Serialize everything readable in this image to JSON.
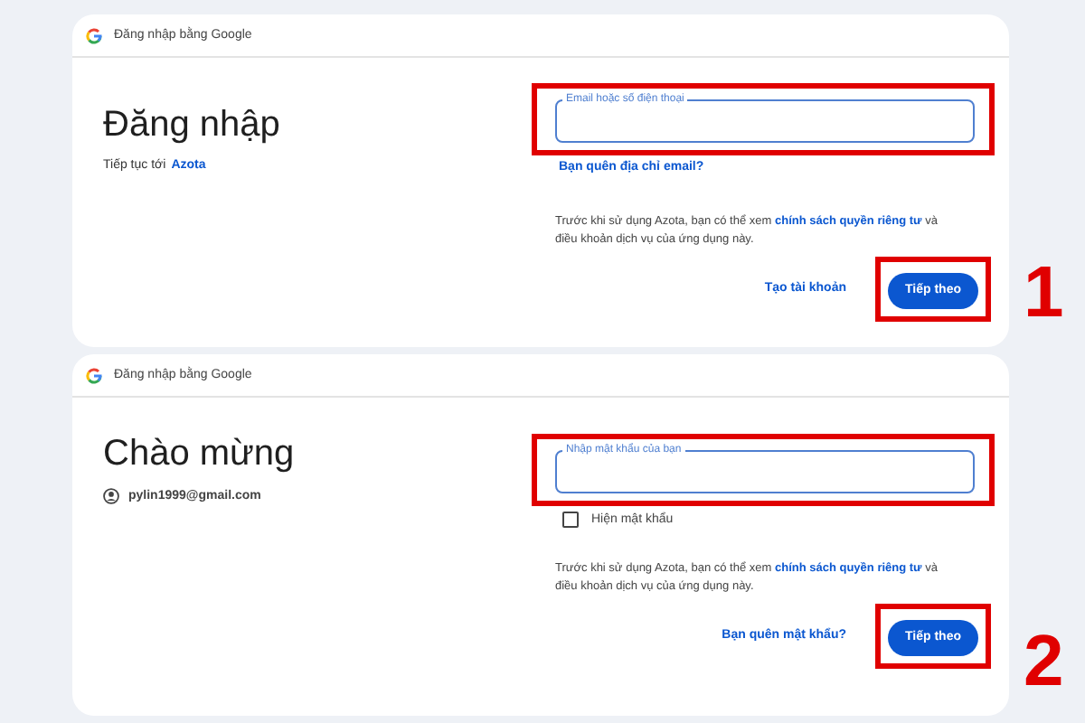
{
  "steps": [
    {
      "kind": "email",
      "header": "Đăng nhập bằng Google",
      "title": "Đăng nhập",
      "subtitle_prefix": "Tiếp tục tới",
      "subtitle_link": "Azota",
      "field_label": "Email hoặc số điện thoại",
      "helper_link": "Bạn quên địa chỉ email?",
      "privacy_before": "Trước khi sử dụng Azota, bạn có thể xem",
      "privacy_link": "chính sách quyền riêng tư",
      "privacy_after": "và điều khoản dịch vụ của ứng dụng này.",
      "secondary_action": "Tạo tài khoản",
      "primary_action": "Tiếp theo",
      "step_number": "1"
    },
    {
      "kind": "password",
      "header": "Đăng nhập bằng Google",
      "title": "Chào mừng",
      "account": "pylin1999@gmail.com",
      "field_label": "Nhập mật khẩu của bạn",
      "show_password": {
        "label": "Hiện mật khẩu",
        "checked": false
      },
      "privacy_before": "Trước khi sử dụng Azota, bạn có thể xem",
      "privacy_link": "chính sách quyền riêng tư",
      "privacy_after": "và điều khoản dịch vụ của ứng dụng này.",
      "secondary_action": "Bạn quên mật khẩu?",
      "primary_action": "Tiếp theo",
      "step_number": "2"
    }
  ]
}
